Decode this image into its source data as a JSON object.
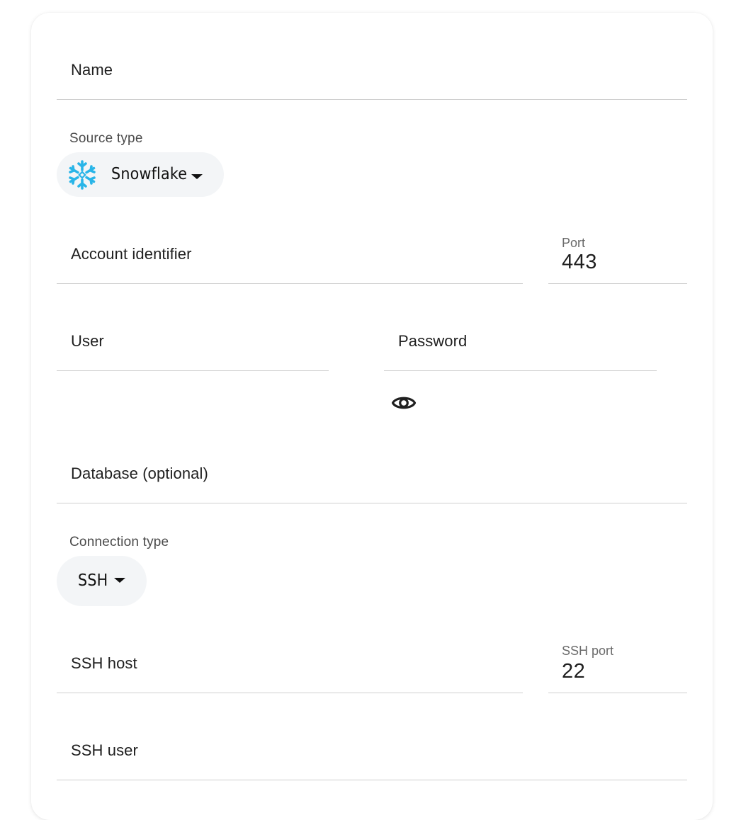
{
  "form": {
    "name_placeholder": "Name",
    "source_type": {
      "label": "Source type",
      "selected": "Snowflake",
      "icon": "snowflake-icon",
      "icon_color": "#29b5e8"
    },
    "account_identifier_placeholder": "Account identifier",
    "port": {
      "label": "Port",
      "value": "443"
    },
    "user_placeholder": "User",
    "password_placeholder": "Password",
    "password_toggle_icon": "eye-icon",
    "database_placeholder": "Database (optional)",
    "connection_type": {
      "label": "Connection type",
      "selected": "SSH"
    },
    "ssh_host_placeholder": "SSH host",
    "ssh_port": {
      "label": "SSH port",
      "value": "22"
    },
    "ssh_user_placeholder": "SSH user"
  }
}
